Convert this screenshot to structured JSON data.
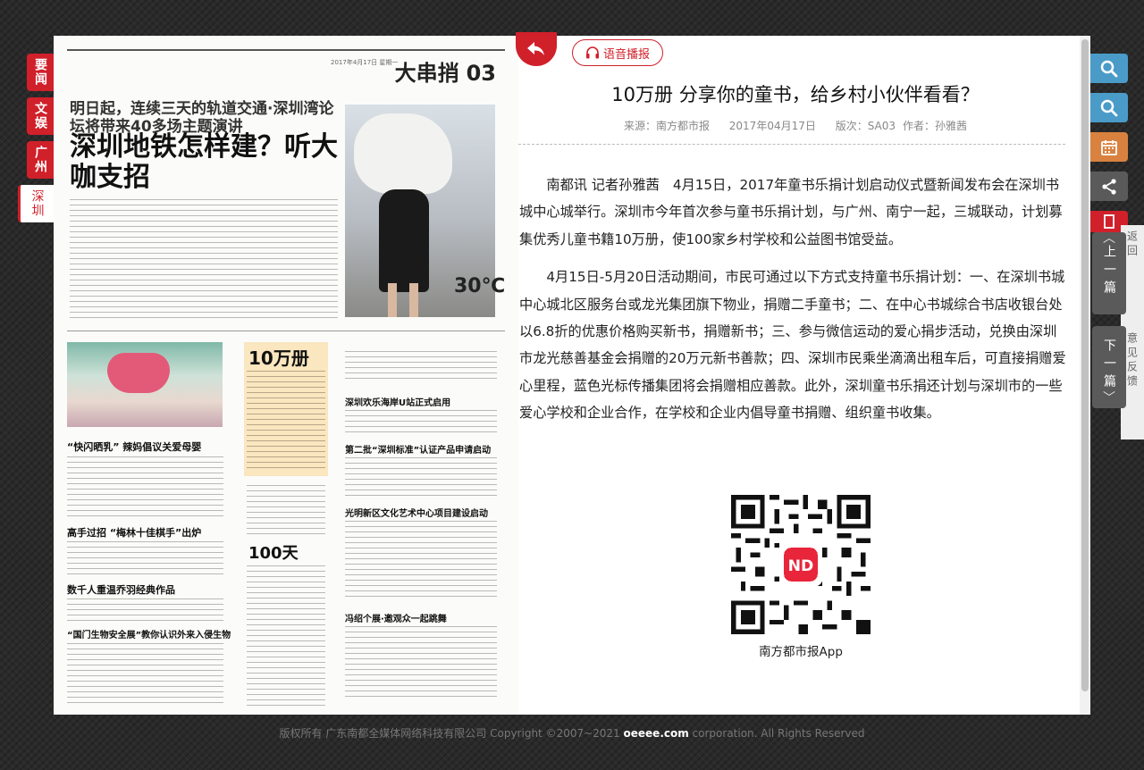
{
  "sections": [
    {
      "label": "要闻",
      "active": false
    },
    {
      "label": "文娱",
      "active": false
    },
    {
      "label": "广州",
      "active": false
    },
    {
      "label": "深圳",
      "active": true
    }
  ],
  "newspaper": {
    "page_name": "大串捎",
    "page_no": "03",
    "subhead": "明日起，连续三天的轨道交通·深圳湾论坛将带来40多场主题演讲",
    "headline": "深圳地铁怎样建？听大咖支招",
    "temperature": "30℃",
    "brief_heads": [
      "“快闪晒乳” 辣妈倡议关爱母婴",
      "高手过招 “梅林十佳棋手”出炉",
      "数千人重温乔羽经典作品",
      "“国门生物安全展”教你认识外来入侵生物",
      "深圳欢乐海岸U站正式启用",
      "第二批“深圳标准”认证产品申请启动",
      "光明新区文化艺术中心项目建设启动",
      "冯绍个展·邀观众一起跳舞"
    ],
    "big_numbers": [
      "10万册",
      "100天"
    ]
  },
  "article": {
    "back_icon": "back-arrow-icon",
    "audio_label": "语音播报",
    "title": "10万册 分享你的童书，给乡村小伙伴看看？",
    "meta": {
      "source": "来源：南方都市报",
      "date": "2017年04月17日",
      "edition": "版次：SA03",
      "author": "作者：孙雅茜"
    },
    "paragraphs": [
      "南都讯 记者孙雅茜　4月15日，2017年童书乐捐计划启动仪式暨新闻发布会在深圳书城中心城举行。深圳市今年首次参与童书乐捐计划，与广州、南宁一起，三城联动，计划募集优秀儿童书籍10万册，使100家乡村学校和公益图书馆受益。",
      "4月15日-5月20日活动期间，市民可通过以下方式支持童书乐捐计划：一、在深圳书城中心城北区服务台或龙光集团旗下物业，捐赠二手童书；二、在中心书城综合书店收银台处以6.8折的优惠价格购买新书，捐赠新书；三、参与微信运动的爱心捐步活动，兑换由深圳市龙光慈善基金会捐赠的20万元新书善款；四、深圳市民乘坐滴滴出租车后，可直接捐赠爱心里程，蓝色光标传播集团将会捐赠相应善款。此外，深圳童书乐捐还计划与深圳市的一些爱心学校和企业合作，在学校和企业内倡导童书捐赠、组织童书收集。"
    ],
    "qr_caption": "南方都市报App",
    "qr_badge": "ND"
  },
  "toolbar": {
    "prev_label": "上一篇",
    "next_label": "下一篇",
    "peek_top": "返回",
    "peek_bottom": "意见反馈",
    "colors": {
      "search": "#4a9bc8",
      "calendar": "#d9823f",
      "share": "#5a5a5a",
      "red": "#d0202a"
    }
  },
  "footer": {
    "prefix": "版权所有 广东南都全媒体网络科技有限公司 Copyright ©2007~2021 ",
    "brand": "oeeee.com",
    "suffix": " corporation. All Rights Reserved"
  }
}
